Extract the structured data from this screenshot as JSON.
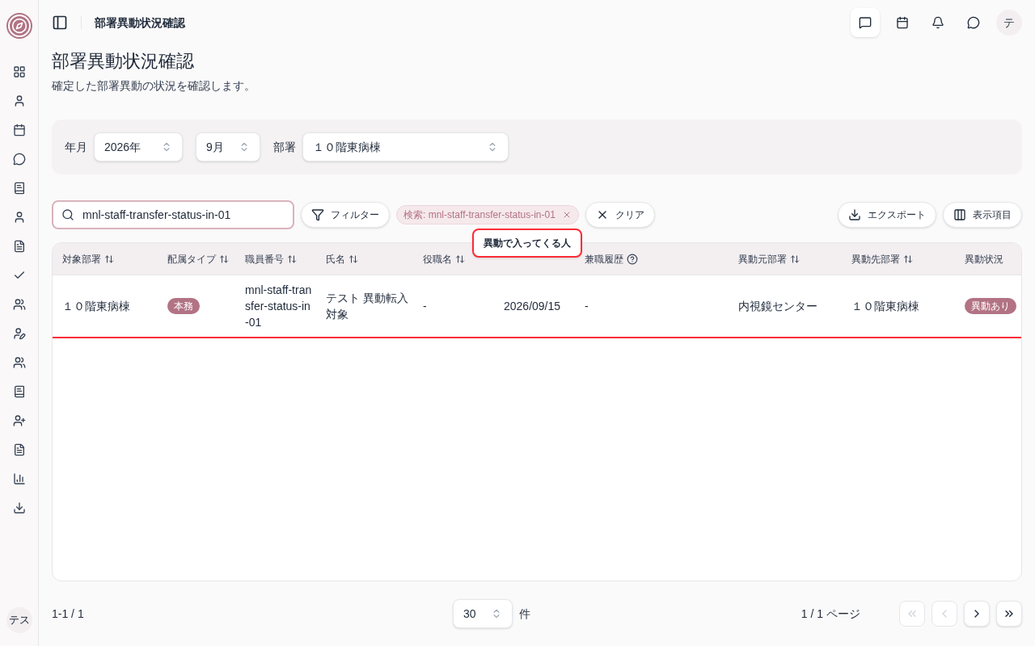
{
  "header": {
    "title": "部署異動状況確認",
    "avatar": "テ"
  },
  "sidebar": {
    "avatar": "テス"
  },
  "page": {
    "title": "部署異動状況確認",
    "description": "確定した部署異動の状況を確認します。"
  },
  "filters": {
    "year_label": "年月",
    "year": "2026年",
    "month": "9月",
    "dept_label": "部署",
    "dept": "１０階東病棟"
  },
  "toolbar": {
    "search_value": "mnl-staff-transfer-status-in-01",
    "filter_button": "フィルター",
    "chip": "検索: mnl-staff-transfer-status-in-01",
    "clear_button": "クリア",
    "export_button": "エクスポート",
    "columns_button": "表示項目"
  },
  "table": {
    "columns": [
      {
        "label": "対象部署",
        "kind": "sortable"
      },
      {
        "label": "配属タイプ",
        "kind": "sortable"
      },
      {
        "label": "職員番号",
        "kind": "sortable"
      },
      {
        "label": "氏名",
        "kind": "sortable"
      },
      {
        "label": "役職名",
        "kind": "sortable"
      },
      {
        "kind": "plain"
      },
      {
        "label": "兼職履歴",
        "kind": "help"
      },
      {
        "label": "異動元部署",
        "kind": "sortable"
      },
      {
        "label": "異動先部署",
        "kind": "sortable"
      },
      {
        "label": "異動状況",
        "kind": "plain"
      }
    ],
    "rows": [
      {
        "highlighted": true,
        "cells": [
          {
            "kind": "text",
            "text": "１０階東病棟"
          },
          {
            "kind": "badge",
            "text": "本務"
          },
          {
            "kind": "text",
            "text": "mnl-staff-transfer-status-in-01"
          },
          {
            "kind": "text",
            "text": "テスト 異動転入対象"
          },
          {
            "kind": "text",
            "text": "-"
          },
          {
            "kind": "text",
            "text": "2026/09/15"
          },
          {
            "kind": "text",
            "text": "-"
          },
          {
            "kind": "text",
            "text": "内視鏡センター"
          },
          {
            "kind": "text",
            "text": "１０階東病棟"
          },
          {
            "kind": "badge",
            "text": "異動あり"
          }
        ]
      }
    ]
  },
  "tooltip": "異動で入ってくる人",
  "footer": {
    "range": "1-1 / 1",
    "page_size": "30",
    "page_size_unit": "件",
    "page_info": "1 / 1 ページ",
    "first_disabled": true,
    "prev_disabled": true,
    "next_disabled": false,
    "last_disabled": false
  }
}
